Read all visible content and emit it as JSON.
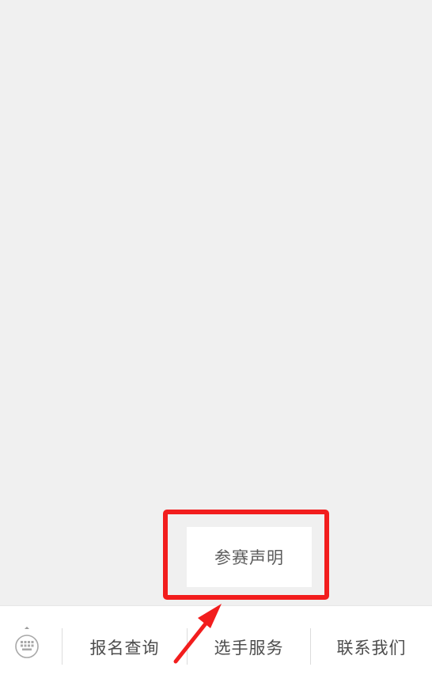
{
  "menu": {
    "items": [
      {
        "label": "报名查询"
      },
      {
        "label": "选手服务"
      },
      {
        "label": "联系我们"
      }
    ],
    "submenu": {
      "items": [
        {
          "label": "参赛声明"
        }
      ]
    }
  },
  "icons": {
    "keyboard": "keyboard-icon",
    "annotation_arrow": "arrow-icon"
  },
  "colors": {
    "highlight": "#f21d1d",
    "background": "#f0f0f0",
    "menu_text": "#4d4d4d"
  }
}
